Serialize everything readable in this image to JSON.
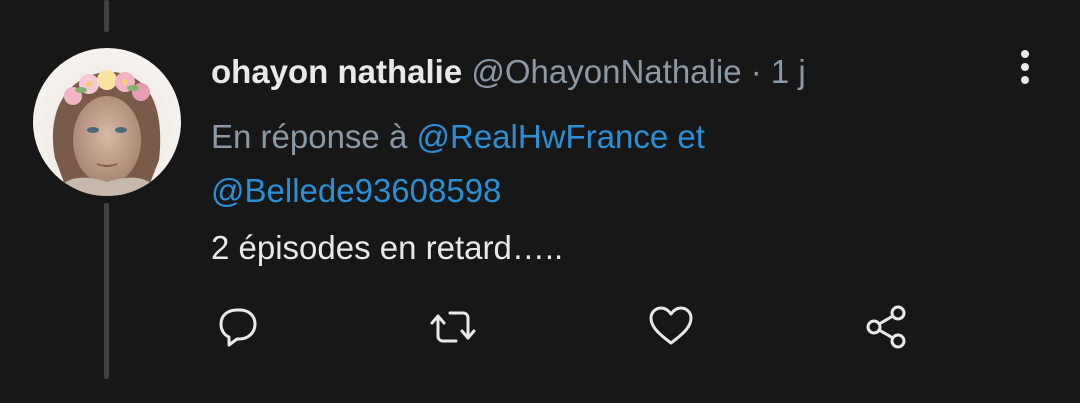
{
  "tweet": {
    "author_name": "ohayon nathalie",
    "author_handle": "@OhayonNathalie",
    "separator": "·",
    "timestamp": "1 j",
    "reply_prefix": "En réponse à",
    "reply_mention_1": "@RealHwFrance",
    "reply_conjunction": "et",
    "reply_mention_2": "@Bellede93608598",
    "text": "2 épisodes en retard….."
  },
  "actions": {
    "icons": [
      "reply-icon",
      "retweet-icon",
      "like-icon",
      "share-icon"
    ]
  },
  "colors": {
    "background": "#171717",
    "primary_text": "#e7e9ea",
    "secondary_text": "#8b98a5",
    "link": "#1d9bf0",
    "thread_line": "#3e4144"
  }
}
